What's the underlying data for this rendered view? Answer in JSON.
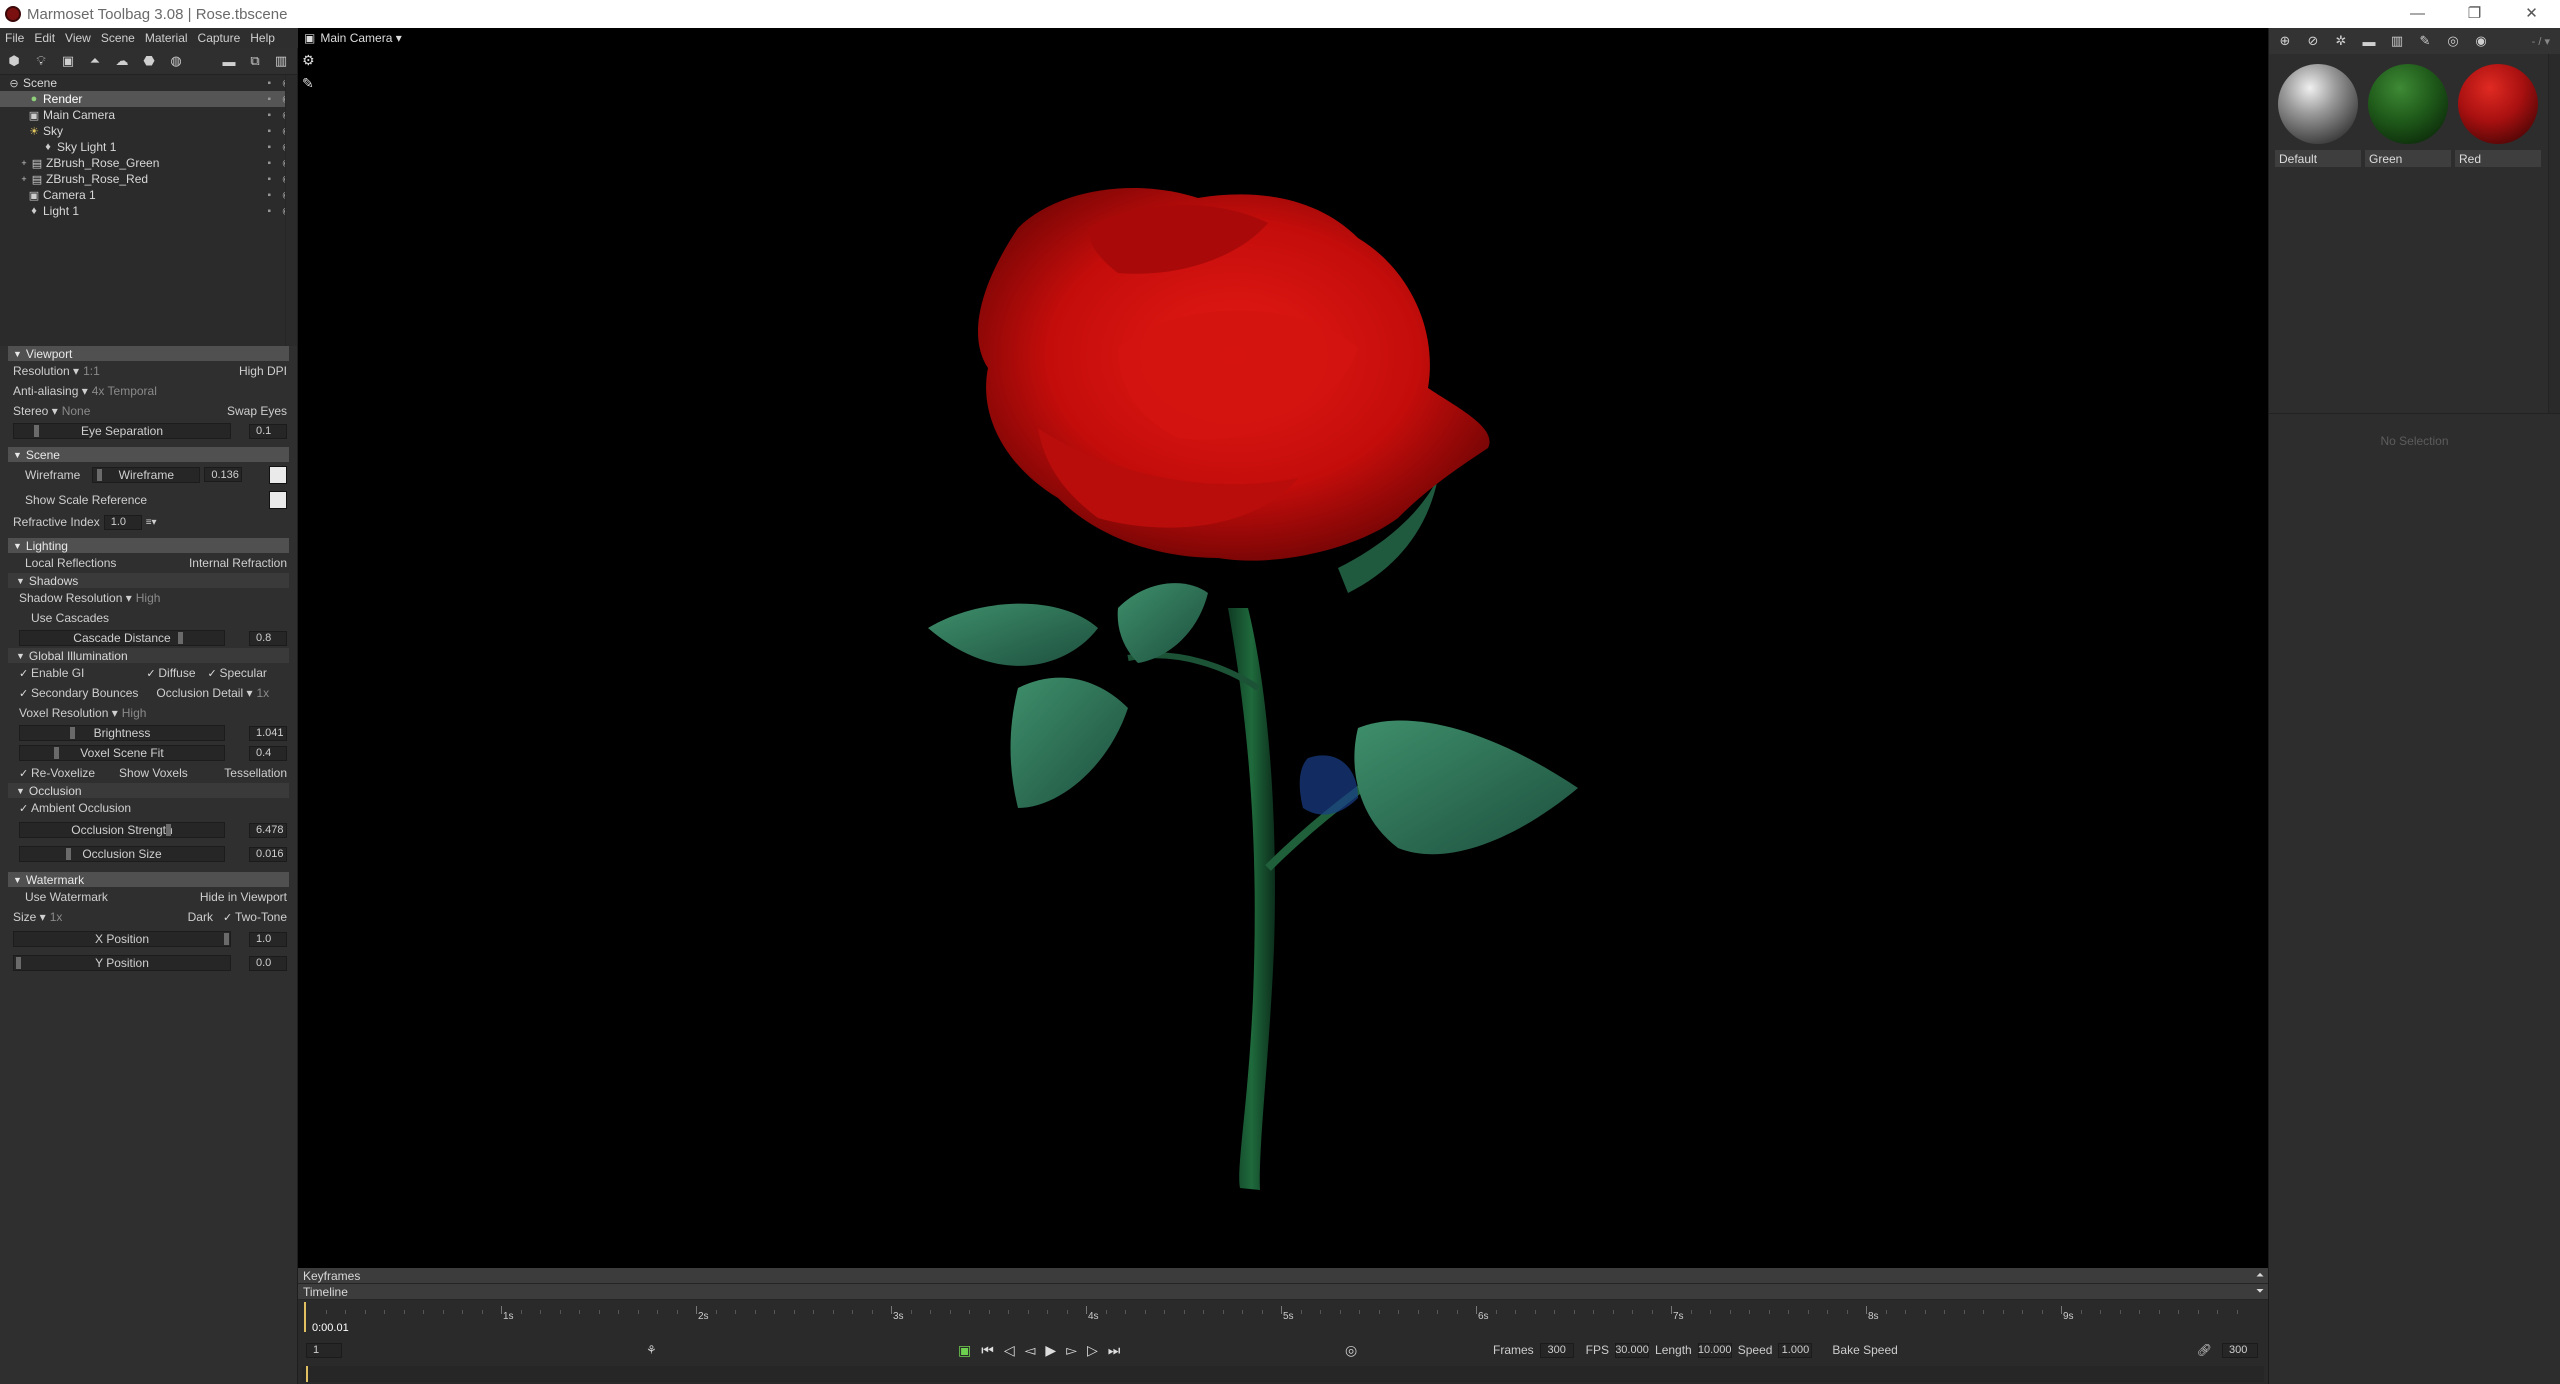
{
  "window": {
    "title": "Marmoset Toolbag 3.08  |  Rose.tbscene",
    "controls": [
      "—",
      "❐",
      "✕"
    ]
  },
  "menu": [
    "File",
    "Edit",
    "View",
    "Scene",
    "Material",
    "Capture",
    "Help"
  ],
  "viewport": {
    "camera_label": "Main Camera ▾"
  },
  "scene_tree": [
    {
      "label": "Scene",
      "indent": 0,
      "icon": "scene-icon",
      "selected": false
    },
    {
      "label": "Render",
      "indent": 1,
      "icon": "render-icon",
      "selected": true
    },
    {
      "label": "Main Camera",
      "indent": 1,
      "icon": "camera-icon",
      "selected": false
    },
    {
      "label": "Sky",
      "indent": 1,
      "icon": "sky-icon",
      "selected": false
    },
    {
      "label": "Sky Light 1",
      "indent": 2,
      "icon": "light-icon",
      "selected": false
    },
    {
      "label": "ZBrush_Rose_Green",
      "indent": 1,
      "icon": "mesh-icon",
      "selected": false
    },
    {
      "label": "ZBrush_Rose_Red",
      "indent": 1,
      "icon": "mesh-icon",
      "selected": false
    },
    {
      "label": "Camera 1",
      "indent": 1,
      "icon": "camera-icon",
      "selected": false
    },
    {
      "label": "Light 1",
      "indent": 1,
      "icon": "light-icon",
      "selected": false
    }
  ],
  "props": {
    "viewport": {
      "title": "Viewport",
      "resolution": "Resolution ▾",
      "resolution_val": "1:1",
      "high_dpi": "High DPI",
      "antialiasing": "Anti-aliasing ▾",
      "antialiasing_val": "4x Temporal",
      "stereo": "Stereo ▾",
      "stereo_val": "None",
      "swap_eyes": "Swap Eyes",
      "eye_sep": "Eye Separation",
      "eye_sep_val": "0.1"
    },
    "scene": {
      "title": "Scene",
      "wireframe": "Wireframe",
      "wireframe_slider": "Wireframe",
      "wireframe_val": "0.136",
      "show_scale": "Show Scale Reference",
      "refractive": "Refractive Index",
      "refractive_val": "1.0",
      "refractive_menu": "≡▾"
    },
    "lighting": {
      "title": "Lighting",
      "local_refl": "Local Reflections",
      "internal_refr": "Internal Refraction",
      "shadows": "Shadows",
      "shadow_res": "Shadow Resolution ▾",
      "shadow_res_val": "High",
      "use_cascades": "Use Cascades",
      "cascade_dist": "Cascade Distance",
      "cascade_dist_val": "0.8",
      "gi": "Global Illumination",
      "enable_gi": "Enable GI",
      "diffuse": "Diffuse",
      "specular": "Specular",
      "secondary": "Secondary Bounces",
      "occ_detail": "Occlusion Detail ▾",
      "occ_detail_val": "1x",
      "voxel_res": "Voxel Resolution ▾",
      "voxel_res_val": "High",
      "brightness": "Brightness",
      "brightness_val": "1.041",
      "voxel_fit": "Voxel Scene Fit",
      "voxel_fit_val": "0.4",
      "revoxelize": "Re-Voxelize",
      "show_voxels": "Show Voxels",
      "tessellation": "Tessellation",
      "occlusion": "Occlusion",
      "ambient_occ": "Ambient Occlusion",
      "occ_strength": "Occlusion Strength",
      "occ_strength_val": "6.478",
      "occ_size": "Occlusion Size",
      "occ_size_val": "0.016"
    },
    "watermark": {
      "title": "Watermark",
      "use": "Use Watermark",
      "hide": "Hide in Viewport",
      "size": "Size ▾",
      "size_val": "1x",
      "dark": "Dark",
      "two_tone": "Two-Tone",
      "xpos": "X Position",
      "xpos_val": "1.0",
      "ypos": "Y Position",
      "ypos_val": "0.0"
    }
  },
  "timeline": {
    "keyframes": "Keyframes",
    "timeline": "Timeline",
    "ticks": [
      "1s",
      "2s",
      "3s",
      "4s",
      "5s",
      "6s",
      "7s",
      "8s",
      "9s"
    ],
    "time": "0:00.01",
    "frame": "1",
    "frames_label": "Frames",
    "frames_val": "300",
    "fps_label": "FPS",
    "fps_val": "30.000",
    "length_label": "Length",
    "length_val": "10.000",
    "speed_label": "Speed",
    "speed_val": "1.000",
    "bake_speed": "Bake Speed",
    "end_val": "300"
  },
  "materials": {
    "zoom": "- / ▾",
    "items": [
      {
        "name": "Default",
        "color": "#9a9a9a"
      },
      {
        "name": "Green",
        "color": "#1f5a1a"
      },
      {
        "name": "Red",
        "color": "#a81010"
      }
    ],
    "no_selection": "No Selection"
  }
}
